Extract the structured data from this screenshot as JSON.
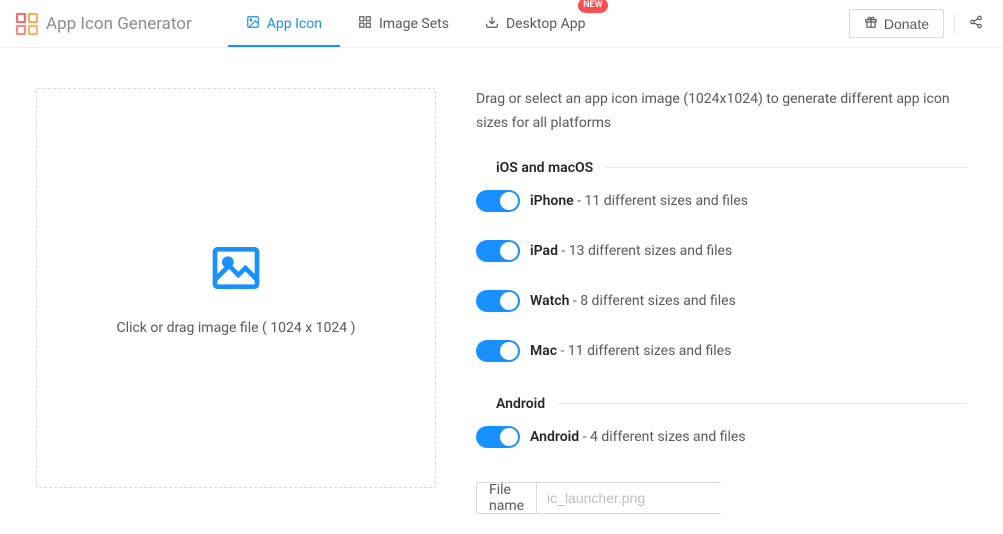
{
  "header": {
    "title": "App Icon Generator",
    "tabs": [
      {
        "label": "App Icon",
        "active": true
      },
      {
        "label": "Image Sets",
        "active": false
      },
      {
        "label": "Desktop App",
        "active": false,
        "badge": "NEW"
      }
    ],
    "donate_label": "Donate"
  },
  "dropzone": {
    "text": "Click or drag image file ( 1024 x 1024 )"
  },
  "panel": {
    "instruction": "Drag or select an app icon image (1024x1024) to generate different app icon sizes for all platforms",
    "sections": [
      {
        "title": "iOS and macOS",
        "items": [
          {
            "name": "iPhone",
            "desc": " - 11 different sizes and files"
          },
          {
            "name": "iPad",
            "desc": " - 13 different sizes and files"
          },
          {
            "name": "Watch",
            "desc": " - 8 different sizes and files"
          },
          {
            "name": "Mac",
            "desc": " - 11 different sizes and files"
          }
        ]
      },
      {
        "title": "Android",
        "items": [
          {
            "name": "Android",
            "desc": " - 4 different sizes and files"
          }
        ]
      }
    ],
    "filename_label": "File name",
    "filename_placeholder": "ic_launcher.png"
  }
}
